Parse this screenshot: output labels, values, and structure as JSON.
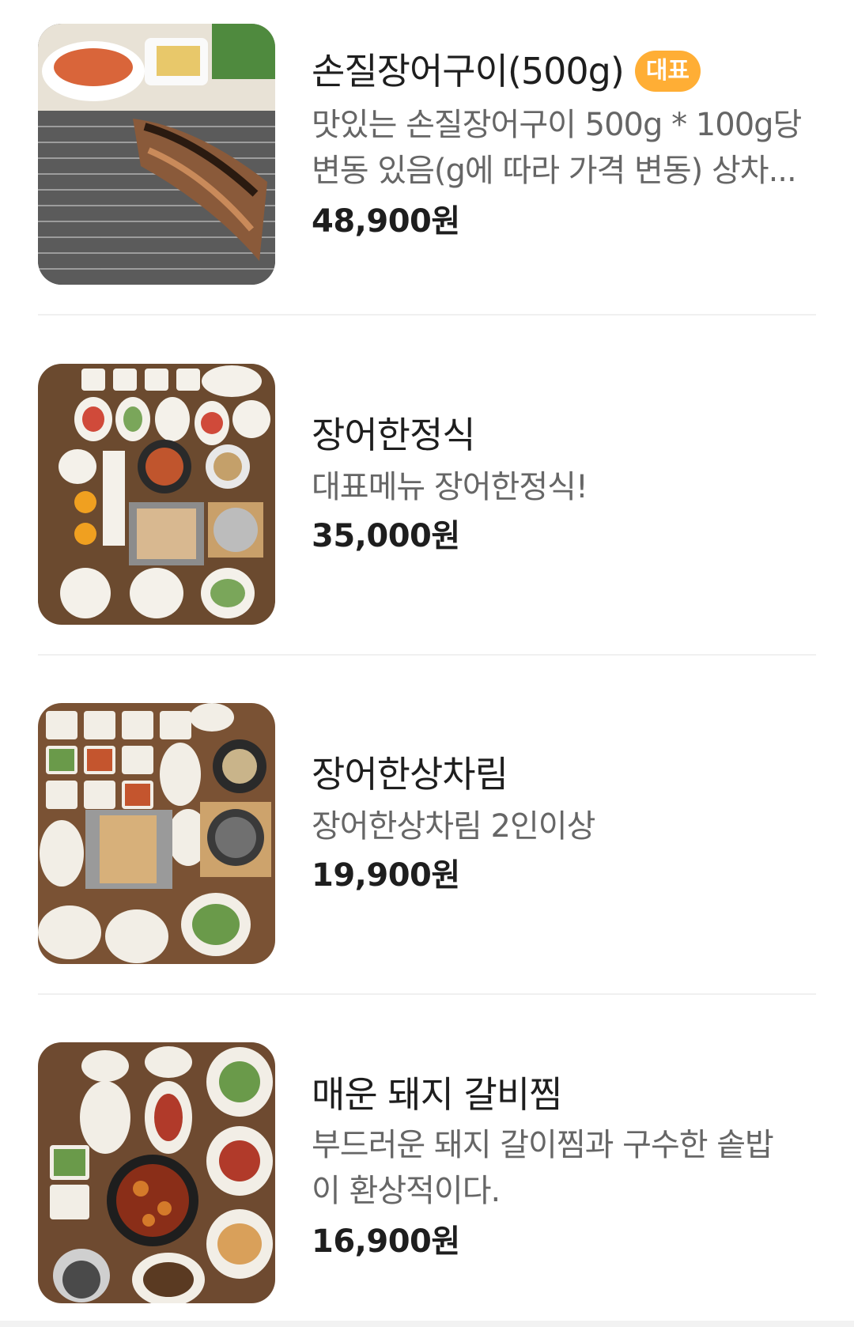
{
  "menu": {
    "items": [
      {
        "name": "손질장어구이(500g)",
        "badge": "대표",
        "desc_lines": [
          "맛있는 손질장어구이 500g * 100g당",
          "변동 있음(g에 따라 가격 변동) 상차..."
        ],
        "price": "48,900원",
        "image": "grilled-eel-photo"
      },
      {
        "name": "장어한정식",
        "badge": "",
        "desc_lines": [
          "대표메뉴 장어한정식!"
        ],
        "price": "35,000원",
        "image": "eel-set-meal-photo"
      },
      {
        "name": "장어한상차림",
        "badge": "",
        "desc_lines": [
          "장어한상차림 2인이상"
        ],
        "price": "19,900원",
        "image": "eel-table-setting-photo"
      },
      {
        "name": "매운 돼지 갈비찜",
        "badge": "",
        "desc_lines": [
          "부드러운 돼지 갈이찜과 구수한 솥밥",
          "이 환상적이다."
        ],
        "price": "16,900원",
        "image": "spicy-pork-rib-photo"
      }
    ]
  },
  "colors": {
    "badge_bg": "#ffae35",
    "title": "#1e1e1e",
    "desc": "#666666",
    "divider": "#f0f0f0"
  }
}
